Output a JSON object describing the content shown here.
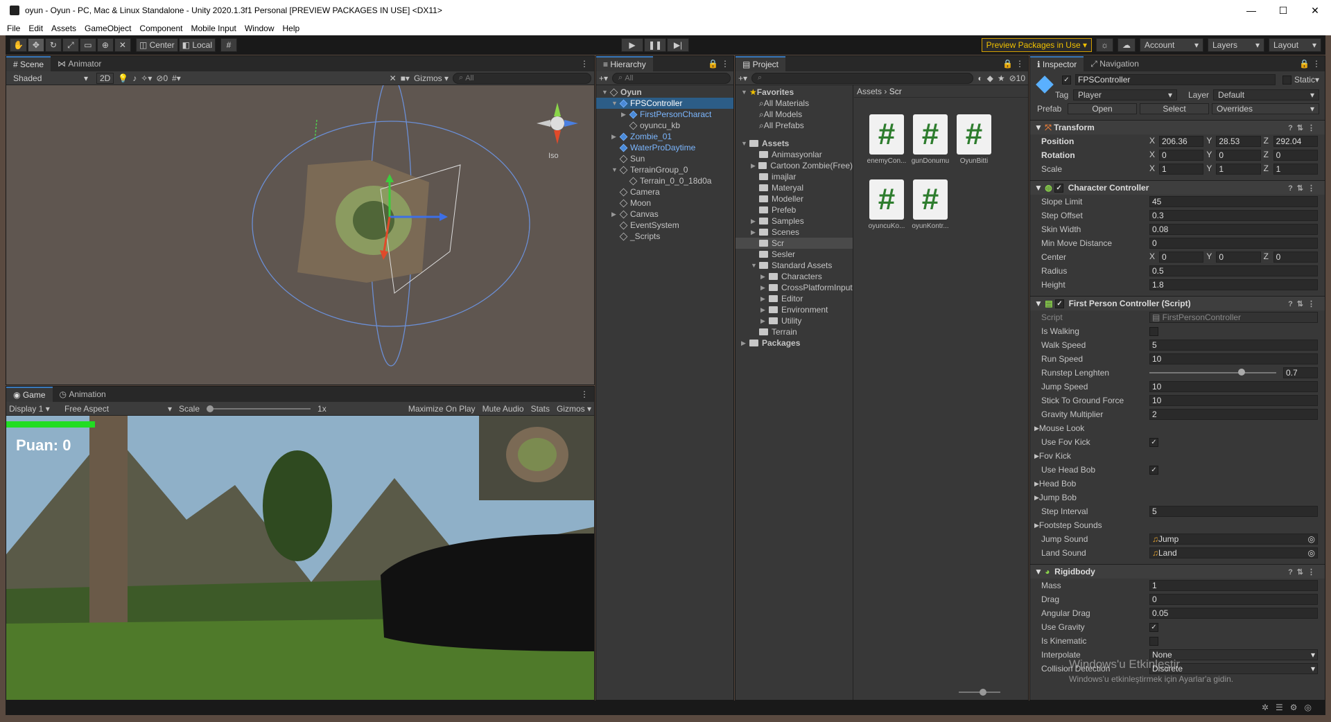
{
  "window": {
    "title": "oyun - Oyun - PC, Mac & Linux Standalone - Unity 2020.1.3f1 Personal [PREVIEW PACKAGES IN USE] <DX11>"
  },
  "menu": [
    "File",
    "Edit",
    "Assets",
    "GameObject",
    "Component",
    "Mobile Input",
    "Window",
    "Help"
  ],
  "toolbar": {
    "center": "Center",
    "local": "Local",
    "preview_packages": "Preview Packages in Use",
    "account": "Account",
    "layers": "Layers",
    "layout": "Layout"
  },
  "scene": {
    "tabs": [
      "Scene",
      "Animator"
    ],
    "shading": "Shaded",
    "mode2d": "2D",
    "gizmos": "Gizmos",
    "search": "All",
    "iso": "Iso",
    "fx_count": "0"
  },
  "game": {
    "tabs": [
      "Game",
      "Animation"
    ],
    "display": "Display 1",
    "aspect": "Free Aspect",
    "scale_label": "Scale",
    "scale_value": "1x",
    "maximize": "Maximize On Play",
    "mute": "Mute Audio",
    "stats": "Stats",
    "gizmos": "Gizmos",
    "score": "Puan: 0"
  },
  "hierarchy": {
    "tab": "Hierarchy",
    "search": "All",
    "items": [
      {
        "label": "Oyun",
        "indent": 0,
        "arrow": "▼",
        "style": "bold"
      },
      {
        "label": "FPSController",
        "indent": 1,
        "arrow": "▼",
        "style": "sel"
      },
      {
        "label": "FirstPersonCharact",
        "indent": 2,
        "arrow": "▶",
        "style": "blue"
      },
      {
        "label": "oyuncu_kb",
        "indent": 2,
        "arrow": "",
        "style": ""
      },
      {
        "label": "Zombie_01",
        "indent": 1,
        "arrow": "▶",
        "style": "blue"
      },
      {
        "label": "WaterProDaytime",
        "indent": 1,
        "arrow": "",
        "style": "blue"
      },
      {
        "label": "Sun",
        "indent": 1,
        "arrow": "",
        "style": ""
      },
      {
        "label": "TerrainGroup_0",
        "indent": 1,
        "arrow": "▼",
        "style": ""
      },
      {
        "label": "Terrain_0_0_18d0a",
        "indent": 2,
        "arrow": "",
        "style": ""
      },
      {
        "label": "Camera",
        "indent": 1,
        "arrow": "",
        "style": ""
      },
      {
        "label": "Moon",
        "indent": 1,
        "arrow": "",
        "style": ""
      },
      {
        "label": "Canvas",
        "indent": 1,
        "arrow": "▶",
        "style": ""
      },
      {
        "label": "EventSystem",
        "indent": 1,
        "arrow": "",
        "style": ""
      },
      {
        "label": "_Scripts",
        "indent": 1,
        "arrow": "",
        "style": ""
      }
    ]
  },
  "project": {
    "tab": "Project",
    "breadcrumb_root": "Assets",
    "breadcrumb_current": "Scr",
    "hidden_count": "10",
    "tree": [
      {
        "label": "Favorites",
        "indent": 0,
        "arrow": "▼",
        "style": "bold"
      },
      {
        "label": "All Materials",
        "indent": 1,
        "arrow": "",
        "style": ""
      },
      {
        "label": "All Models",
        "indent": 1,
        "arrow": "",
        "style": ""
      },
      {
        "label": "All Prefabs",
        "indent": 1,
        "arrow": "",
        "style": ""
      },
      {
        "label": "",
        "indent": 0,
        "arrow": "",
        "style": "spacer"
      },
      {
        "label": "Assets",
        "indent": 0,
        "arrow": "▼",
        "style": "bold"
      },
      {
        "label": "Animasyonlar",
        "indent": 1,
        "arrow": "",
        "style": ""
      },
      {
        "label": "Cartoon Zombie(Free)",
        "indent": 1,
        "arrow": "▶",
        "style": ""
      },
      {
        "label": "imajlar",
        "indent": 1,
        "arrow": "",
        "style": ""
      },
      {
        "label": "Materyal",
        "indent": 1,
        "arrow": "",
        "style": ""
      },
      {
        "label": "Modeller",
        "indent": 1,
        "arrow": "",
        "style": ""
      },
      {
        "label": "Prefeb",
        "indent": 1,
        "arrow": "",
        "style": ""
      },
      {
        "label": "Samples",
        "indent": 1,
        "arrow": "▶",
        "style": ""
      },
      {
        "label": "Scenes",
        "indent": 1,
        "arrow": "▶",
        "style": ""
      },
      {
        "label": "Scr",
        "indent": 1,
        "arrow": "",
        "style": "hl"
      },
      {
        "label": "Sesler",
        "indent": 1,
        "arrow": "",
        "style": ""
      },
      {
        "label": "Standard Assets",
        "indent": 1,
        "arrow": "▼",
        "style": ""
      },
      {
        "label": "Characters",
        "indent": 2,
        "arrow": "▶",
        "style": ""
      },
      {
        "label": "CrossPlatformInput",
        "indent": 2,
        "arrow": "▶",
        "style": ""
      },
      {
        "label": "Editor",
        "indent": 2,
        "arrow": "▶",
        "style": ""
      },
      {
        "label": "Environment",
        "indent": 2,
        "arrow": "▶",
        "style": ""
      },
      {
        "label": "Utility",
        "indent": 2,
        "arrow": "▶",
        "style": ""
      },
      {
        "label": "Terrain",
        "indent": 1,
        "arrow": "",
        "style": ""
      },
      {
        "label": "Packages",
        "indent": 0,
        "arrow": "▶",
        "style": "bold"
      }
    ],
    "assets": [
      "enemyCon...",
      "gunDonumu",
      "OyunBitti",
      "oyuncuKo...",
      "oyunKontr..."
    ]
  },
  "inspector": {
    "tabs": [
      "Inspector",
      "Navigation"
    ],
    "object_name": "FPSController",
    "static_label": "Static",
    "tag_label": "Tag",
    "tag_value": "Player",
    "layer_label": "Layer",
    "layer_value": "Default",
    "prefab_label": "Prefab",
    "open": "Open",
    "select": "Select",
    "overrides": "Overrides",
    "transform": {
      "title": "Transform",
      "position_label": "Position",
      "position": [
        "206.36",
        "28.53",
        "292.04"
      ],
      "rotation_label": "Rotation",
      "rotation": [
        "0",
        "0",
        "0"
      ],
      "scale_label": "Scale",
      "scale": [
        "1",
        "1",
        "1"
      ]
    },
    "cc": {
      "title": "Character Controller",
      "rows": [
        {
          "label": "Slope Limit",
          "value": "45"
        },
        {
          "label": "Step Offset",
          "value": "0.3"
        },
        {
          "label": "Skin Width",
          "value": "0.08"
        },
        {
          "label": "Min Move Distance",
          "value": "0"
        }
      ],
      "center_label": "Center",
      "center": [
        "0",
        "0",
        "0"
      ],
      "rows2": [
        {
          "label": "Radius",
          "value": "0.5"
        },
        {
          "label": "Height",
          "value": "1.8"
        }
      ]
    },
    "fpc": {
      "title": "First Person Controller (Script)",
      "script_label": "Script",
      "script_value": "FirstPersonController",
      "rows": [
        {
          "label": "Is Walking",
          "kind": "check",
          "value": ""
        },
        {
          "label": "Walk Speed",
          "kind": "field",
          "value": "5"
        },
        {
          "label": "Run Speed",
          "kind": "field",
          "value": "10"
        },
        {
          "label": "Runstep Lenghten",
          "kind": "slider",
          "value": "0.7"
        },
        {
          "label": "Jump Speed",
          "kind": "field",
          "value": "10"
        },
        {
          "label": "Stick To Ground Force",
          "kind": "field",
          "value": "10"
        },
        {
          "label": "Gravity Multiplier",
          "kind": "field",
          "value": "2"
        },
        {
          "label": "Mouse Look",
          "kind": "fold",
          "value": ""
        },
        {
          "label": "Use Fov Kick",
          "kind": "check",
          "value": "✓"
        },
        {
          "label": "Fov Kick",
          "kind": "fold",
          "value": ""
        },
        {
          "label": "Use Head Bob",
          "kind": "check",
          "value": "✓"
        },
        {
          "label": "Head Bob",
          "kind": "fold",
          "value": ""
        },
        {
          "label": "Jump Bob",
          "kind": "fold",
          "value": ""
        },
        {
          "label": "Step Interval",
          "kind": "field",
          "value": "5"
        },
        {
          "label": "Footstep Sounds",
          "kind": "fold",
          "value": ""
        },
        {
          "label": "Jump Sound",
          "kind": "obj",
          "value": "Jump"
        },
        {
          "label": "Land Sound",
          "kind": "obj",
          "value": "Land"
        }
      ]
    },
    "rb": {
      "title": "Rigidbody",
      "rows": [
        {
          "label": "Mass",
          "kind": "field",
          "value": "1"
        },
        {
          "label": "Drag",
          "kind": "field",
          "value": "0"
        },
        {
          "label": "Angular Drag",
          "kind": "field",
          "value": "0.05"
        },
        {
          "label": "Use Gravity",
          "kind": "check",
          "value": "✓"
        },
        {
          "label": "Is Kinematic",
          "kind": "check",
          "value": ""
        },
        {
          "label": "Interpolate",
          "kind": "drop",
          "value": "None"
        },
        {
          "label": "Collision Detection",
          "kind": "drop",
          "value": "Discrete"
        }
      ]
    }
  },
  "watermark": {
    "line1": "Windows'u Etkinleştir",
    "line2": "Windows'u etkinleştirmek için Ayarlar'a gidin."
  }
}
